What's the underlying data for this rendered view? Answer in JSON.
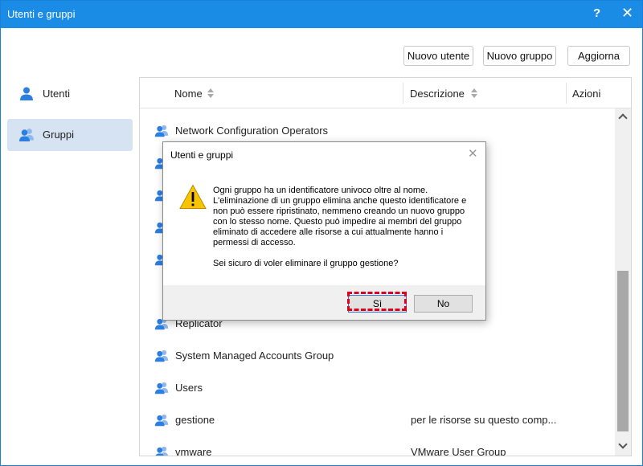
{
  "window": {
    "title": "Utenti e gruppi",
    "help_glyph": "?",
    "close_glyph": "✕"
  },
  "toolbar": {
    "new_user": "Nuovo utente",
    "new_group": "Nuovo gruppo",
    "refresh": "Aggiorna"
  },
  "sidebar": {
    "items": [
      {
        "label": "Utenti"
      },
      {
        "label": "Gruppi",
        "active": true
      }
    ]
  },
  "table": {
    "headers": {
      "name": "Nome",
      "description": "Descrizione",
      "actions": "Azioni"
    },
    "rows": [
      {
        "name": "Network Configuration Operators",
        "description": ""
      },
      {
        "name": "Replicator",
        "description": ""
      },
      {
        "name": "System Managed Accounts Group",
        "description": ""
      },
      {
        "name": "Users",
        "description": ""
      },
      {
        "name": "gestione",
        "description": "per le risorse su questo comp..."
      },
      {
        "name": "vmware",
        "description": "VMware User Group"
      }
    ]
  },
  "dialog": {
    "title": "Utenti e gruppi",
    "close_glyph": "✕",
    "message": "Ogni gruppo ha un identificatore univoco oltre al nome. L'eliminazione di un gruppo elimina anche questo identificatore e non può essere ripristinato, nemmeno creando un nuovo gruppo con lo stesso nome. Questo può impedire ai membri del gruppo eliminato di accedere alle risorse a cui attualmente hanno i permessi di accesso.",
    "question": "Sei sicuro di voler eliminare il gruppo gestione?",
    "yes": "Sì",
    "no": "No"
  },
  "colors": {
    "titlebar": "#1a8ce6",
    "accent_icon": "#2b7fe0",
    "active_sidebar": "#d6e3f3",
    "focus_ring": "#e0001b",
    "warning": "#f7c500"
  },
  "icons": {
    "user": "user-icon",
    "group": "group-icon",
    "warning": "warning-icon"
  }
}
